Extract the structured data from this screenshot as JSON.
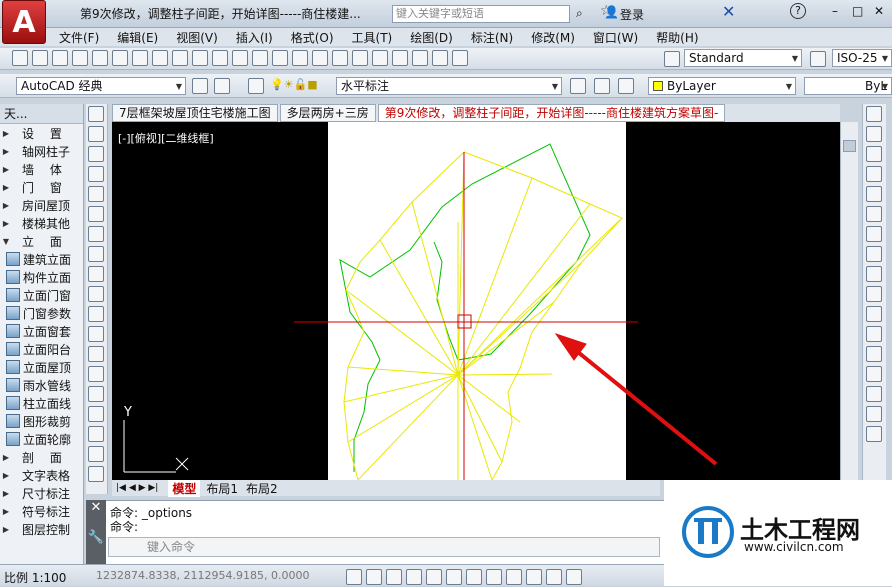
{
  "app": {
    "logo_letter": "A"
  },
  "title": {
    "doc": "第9次修改，调整柱子间距，开始详图-----商住楼建...",
    "search_placeholder": "键入关键字或短语",
    "login": "登录"
  },
  "menu": [
    "文件(F)",
    "编辑(E)",
    "视图(V)",
    "插入(I)",
    "格式(O)",
    "工具(T)",
    "绘图(D)",
    "标注(N)",
    "修改(M)",
    "窗口(W)",
    "帮助(H)"
  ],
  "toolbar": {
    "text_style": "Standard",
    "dim_style": "ISO-25",
    "workspace": "AutoCAD 经典",
    "layer": "水平标注",
    "color": "ByLayer",
    "linetype": "ByL"
  },
  "left_panel": {
    "title": "天...",
    "items": [
      {
        "label": "设　 置",
        "tri": "▶"
      },
      {
        "label": "轴网柱子",
        "tri": "▶"
      },
      {
        "label": "墙　 体",
        "tri": "▶"
      },
      {
        "label": "门　 窗",
        "tri": "▶"
      },
      {
        "label": "房间屋顶",
        "tri": "▶"
      },
      {
        "label": "楼梯其他",
        "tri": "▶"
      },
      {
        "label": "立　 面",
        "tri": "▼"
      },
      {
        "label": "建筑立面",
        "icon": true
      },
      {
        "label": "构件立面",
        "icon": true
      },
      {
        "label": "立面门窗",
        "icon": true
      },
      {
        "label": "门窗参数",
        "icon": true
      },
      {
        "label": "立面窗套",
        "icon": true
      },
      {
        "label": "立面阳台",
        "icon": true
      },
      {
        "label": "立面屋顶",
        "icon": true
      },
      {
        "label": "雨水管线",
        "icon": true
      },
      {
        "label": "柱立面线",
        "icon": true
      },
      {
        "label": "图形裁剪",
        "icon": true
      },
      {
        "label": "立面轮廓",
        "icon": true
      },
      {
        "label": "剖　 面",
        "tri": "▶"
      },
      {
        "label": "文字表格",
        "tri": "▶"
      },
      {
        "label": "尺寸标注",
        "tri": "▶"
      },
      {
        "label": "符号标注",
        "tri": "▶"
      },
      {
        "label": "图层控制",
        "tri": "▶"
      }
    ]
  },
  "doc_tabs": [
    "7层框架坡屋顶住宅楼施工图",
    "多层两房+三房",
    "第9次修改，调整柱子间距，开始详图-----商住楼建筑方案草图-"
  ],
  "view_label": "[-][俯视][二维线框]",
  "layout_tabs": [
    "模型",
    "布局1",
    "布局2"
  ],
  "cmd": {
    "line1": "命令: _options",
    "line2": "命令:",
    "input_placeholder": "键入命令"
  },
  "status": {
    "scale": "比例 1:100",
    "coords": "1232874.8338, 2112954.9185, 0.0000"
  },
  "watermark": {
    "brand": "土木工程网",
    "url": "www.civilcn.com"
  },
  "colors": {
    "green_outline": "#00c000",
    "yellow_lines": "#e8e800",
    "crosshair": "#d00000",
    "arrow": "#e01010"
  }
}
